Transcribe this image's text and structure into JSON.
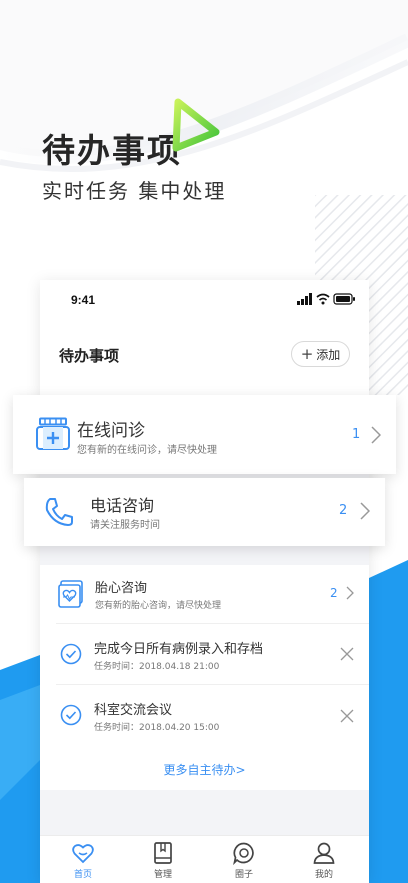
{
  "hero": {
    "title": "待办事项",
    "subtitle": "实时任务 集中处理"
  },
  "phone": {
    "status_time": "9:41",
    "page_title": "待办事项",
    "add_button_label": "添加"
  },
  "cards": [
    {
      "icon": "medicine-box-icon",
      "title": "在线问诊",
      "subtitle": "您有新的在线问诊，请尽快处理",
      "count": "1"
    },
    {
      "icon": "phone-icon",
      "title": "电话咨询",
      "subtitle": "请关注服务时间",
      "count": "2"
    }
  ],
  "list": [
    {
      "icon": "fetal-heart-icon",
      "title": "胎心咨询",
      "subtitle": "您有新的胎心咨询，请尽快处理",
      "count": "2"
    },
    {
      "icon": "check-circle-icon",
      "title": "完成今日所有病例录入和存档",
      "subtitle": "任务时间：2018.04.18 21:00"
    },
    {
      "icon": "check-circle-icon",
      "title": "科室交流会议",
      "subtitle": "任务时间：2018.04.20 15:00"
    }
  ],
  "more_link": "更多自主待办>",
  "tabs": [
    {
      "icon": "heart-home-icon",
      "label": "首页",
      "active": true
    },
    {
      "icon": "book-icon",
      "label": "管理",
      "active": false
    },
    {
      "icon": "chat-bubble-icon",
      "label": "圈子",
      "active": false
    },
    {
      "icon": "user-icon",
      "label": "我的",
      "active": false
    }
  ],
  "colors": {
    "accent": "#3a8ff2",
    "bottom_bg": "#1f9bf0",
    "logo_green": "#7ddb3b"
  }
}
